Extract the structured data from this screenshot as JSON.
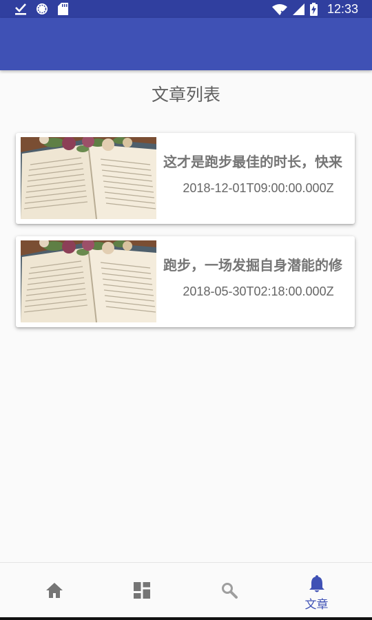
{
  "status_bar": {
    "time": "12:33",
    "icons": [
      "download-done-icon",
      "sync-icon",
      "sd-card-icon",
      "wifi-icon",
      "signal-icon",
      "battery-icon"
    ]
  },
  "page": {
    "title": "文章列表"
  },
  "articles": [
    {
      "title": "这才是跑步最佳的时长，快来",
      "date": "2018-12-01T09:00:00.000Z",
      "thumbnail": "open-book-with-flowers"
    },
    {
      "title": "跑步，一场发掘自身潜能的修",
      "date": "2018-05-30T02:18:00.000Z",
      "thumbnail": "open-book-with-flowers"
    }
  ],
  "bottom_nav": {
    "items": [
      {
        "icon": "home-icon",
        "label": "",
        "active": false
      },
      {
        "icon": "dashboard-icon",
        "label": "",
        "active": false
      },
      {
        "icon": "search-icon",
        "label": "",
        "active": false
      },
      {
        "icon": "bell-icon",
        "label": "文章",
        "active": true
      }
    ]
  },
  "colors": {
    "status_bar": "#303f9f",
    "app_bar": "#3f51b5",
    "accent": "#3f51b5",
    "inactive_icon": "#757575",
    "background": "#fafafa"
  }
}
